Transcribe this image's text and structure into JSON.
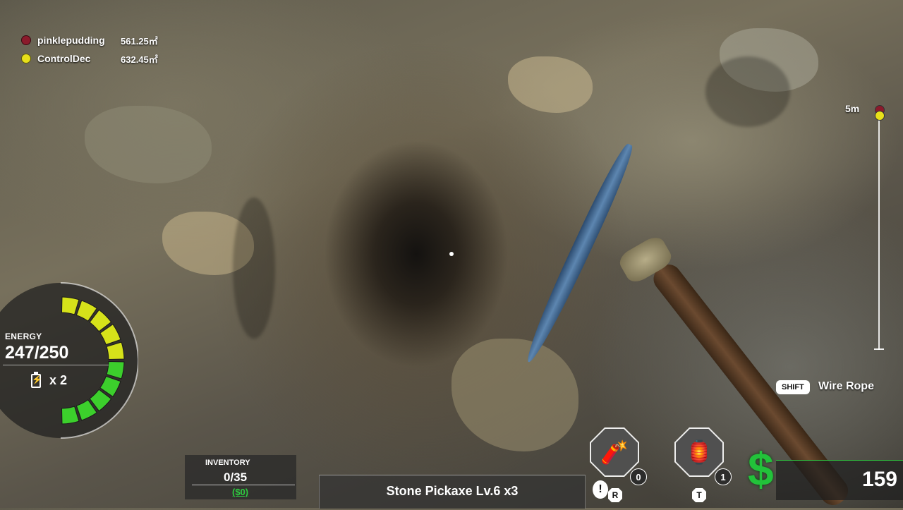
{
  "players": [
    {
      "name": "pinklepudding",
      "distance": "561.25㎡",
      "color": "#8b1a2b"
    },
    {
      "name": "ControlDec",
      "distance": "632.45㎡",
      "color": "#e8e01a"
    }
  ],
  "depth": {
    "label": "5m"
  },
  "energy": {
    "label": "ENERGY",
    "value": "247/250",
    "battery_count": "x 2",
    "fraction": 0.988,
    "accent": "#c6e21a"
  },
  "inventory": {
    "label": "INVENTORY",
    "count": "0/35",
    "money": "($0)"
  },
  "tool": {
    "name": "Stone Pickaxe Lv.6 x3"
  },
  "items": [
    {
      "icon": "dynamite-icon",
      "count": "0",
      "key": "R"
    },
    {
      "icon": "lantern-icon",
      "count": "1",
      "key": "T"
    }
  ],
  "alert": {
    "text": "!"
  },
  "shift_hint": {
    "key": "SHIFT",
    "label": "Wire Rope"
  },
  "money": {
    "symbol": "$",
    "value": "159",
    "color": "#22c23a"
  }
}
